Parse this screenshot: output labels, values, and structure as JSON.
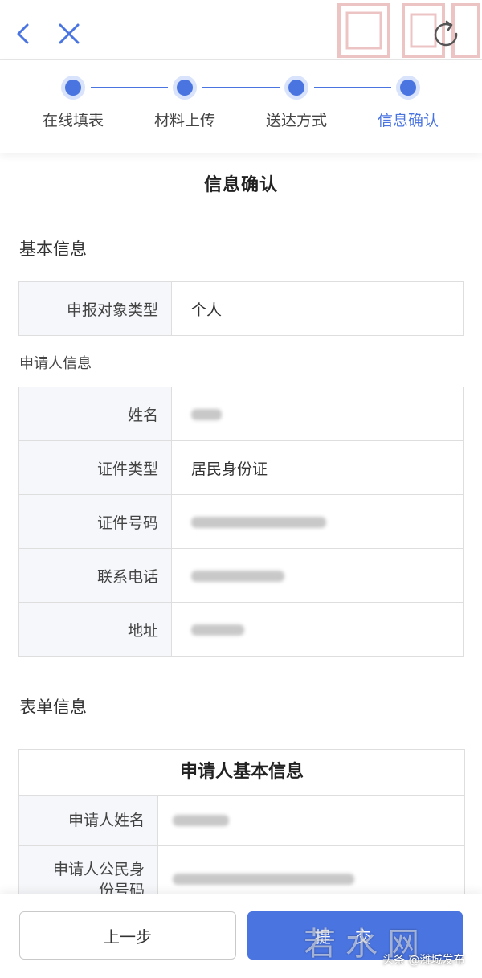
{
  "nav": {
    "back_icon": "chevron-left-icon",
    "close_icon": "close-icon",
    "refresh_icon": "refresh-icon"
  },
  "steps": [
    {
      "label": "在线填表",
      "state": "done"
    },
    {
      "label": "材料上传",
      "state": "done"
    },
    {
      "label": "送达方式",
      "state": "done"
    },
    {
      "label": "信息确认",
      "state": "active"
    }
  ],
  "page_title": "信息确认",
  "basic_info": {
    "title": "基本信息",
    "rows": [
      {
        "label": "申报对象类型",
        "value": "个人"
      }
    ]
  },
  "applicant_info": {
    "title": "申请人信息",
    "rows": [
      {
        "label": "姓名",
        "value": ""
      },
      {
        "label": "证件类型",
        "value": "居民身份证"
      },
      {
        "label": "证件号码",
        "value": ""
      },
      {
        "label": "联系电话",
        "value": ""
      },
      {
        "label": "地址",
        "value": ""
      }
    ]
  },
  "form_info": {
    "title": "表单信息",
    "table_title": "申请人基本信息",
    "rows": [
      {
        "label": "申请人姓名",
        "value": ""
      },
      {
        "label": "申请人公民身份号码",
        "value": ""
      }
    ]
  },
  "footer": {
    "prev_label": "上一步",
    "submit_label": "提交"
  },
  "watermark": {
    "big": "若水网",
    "small": "头条 @潍城发布"
  },
  "colors": {
    "accent": "#4a74e0",
    "accent_light": "#d9e3fb",
    "label_bg": "#f5f7fa",
    "border": "#dedede"
  }
}
